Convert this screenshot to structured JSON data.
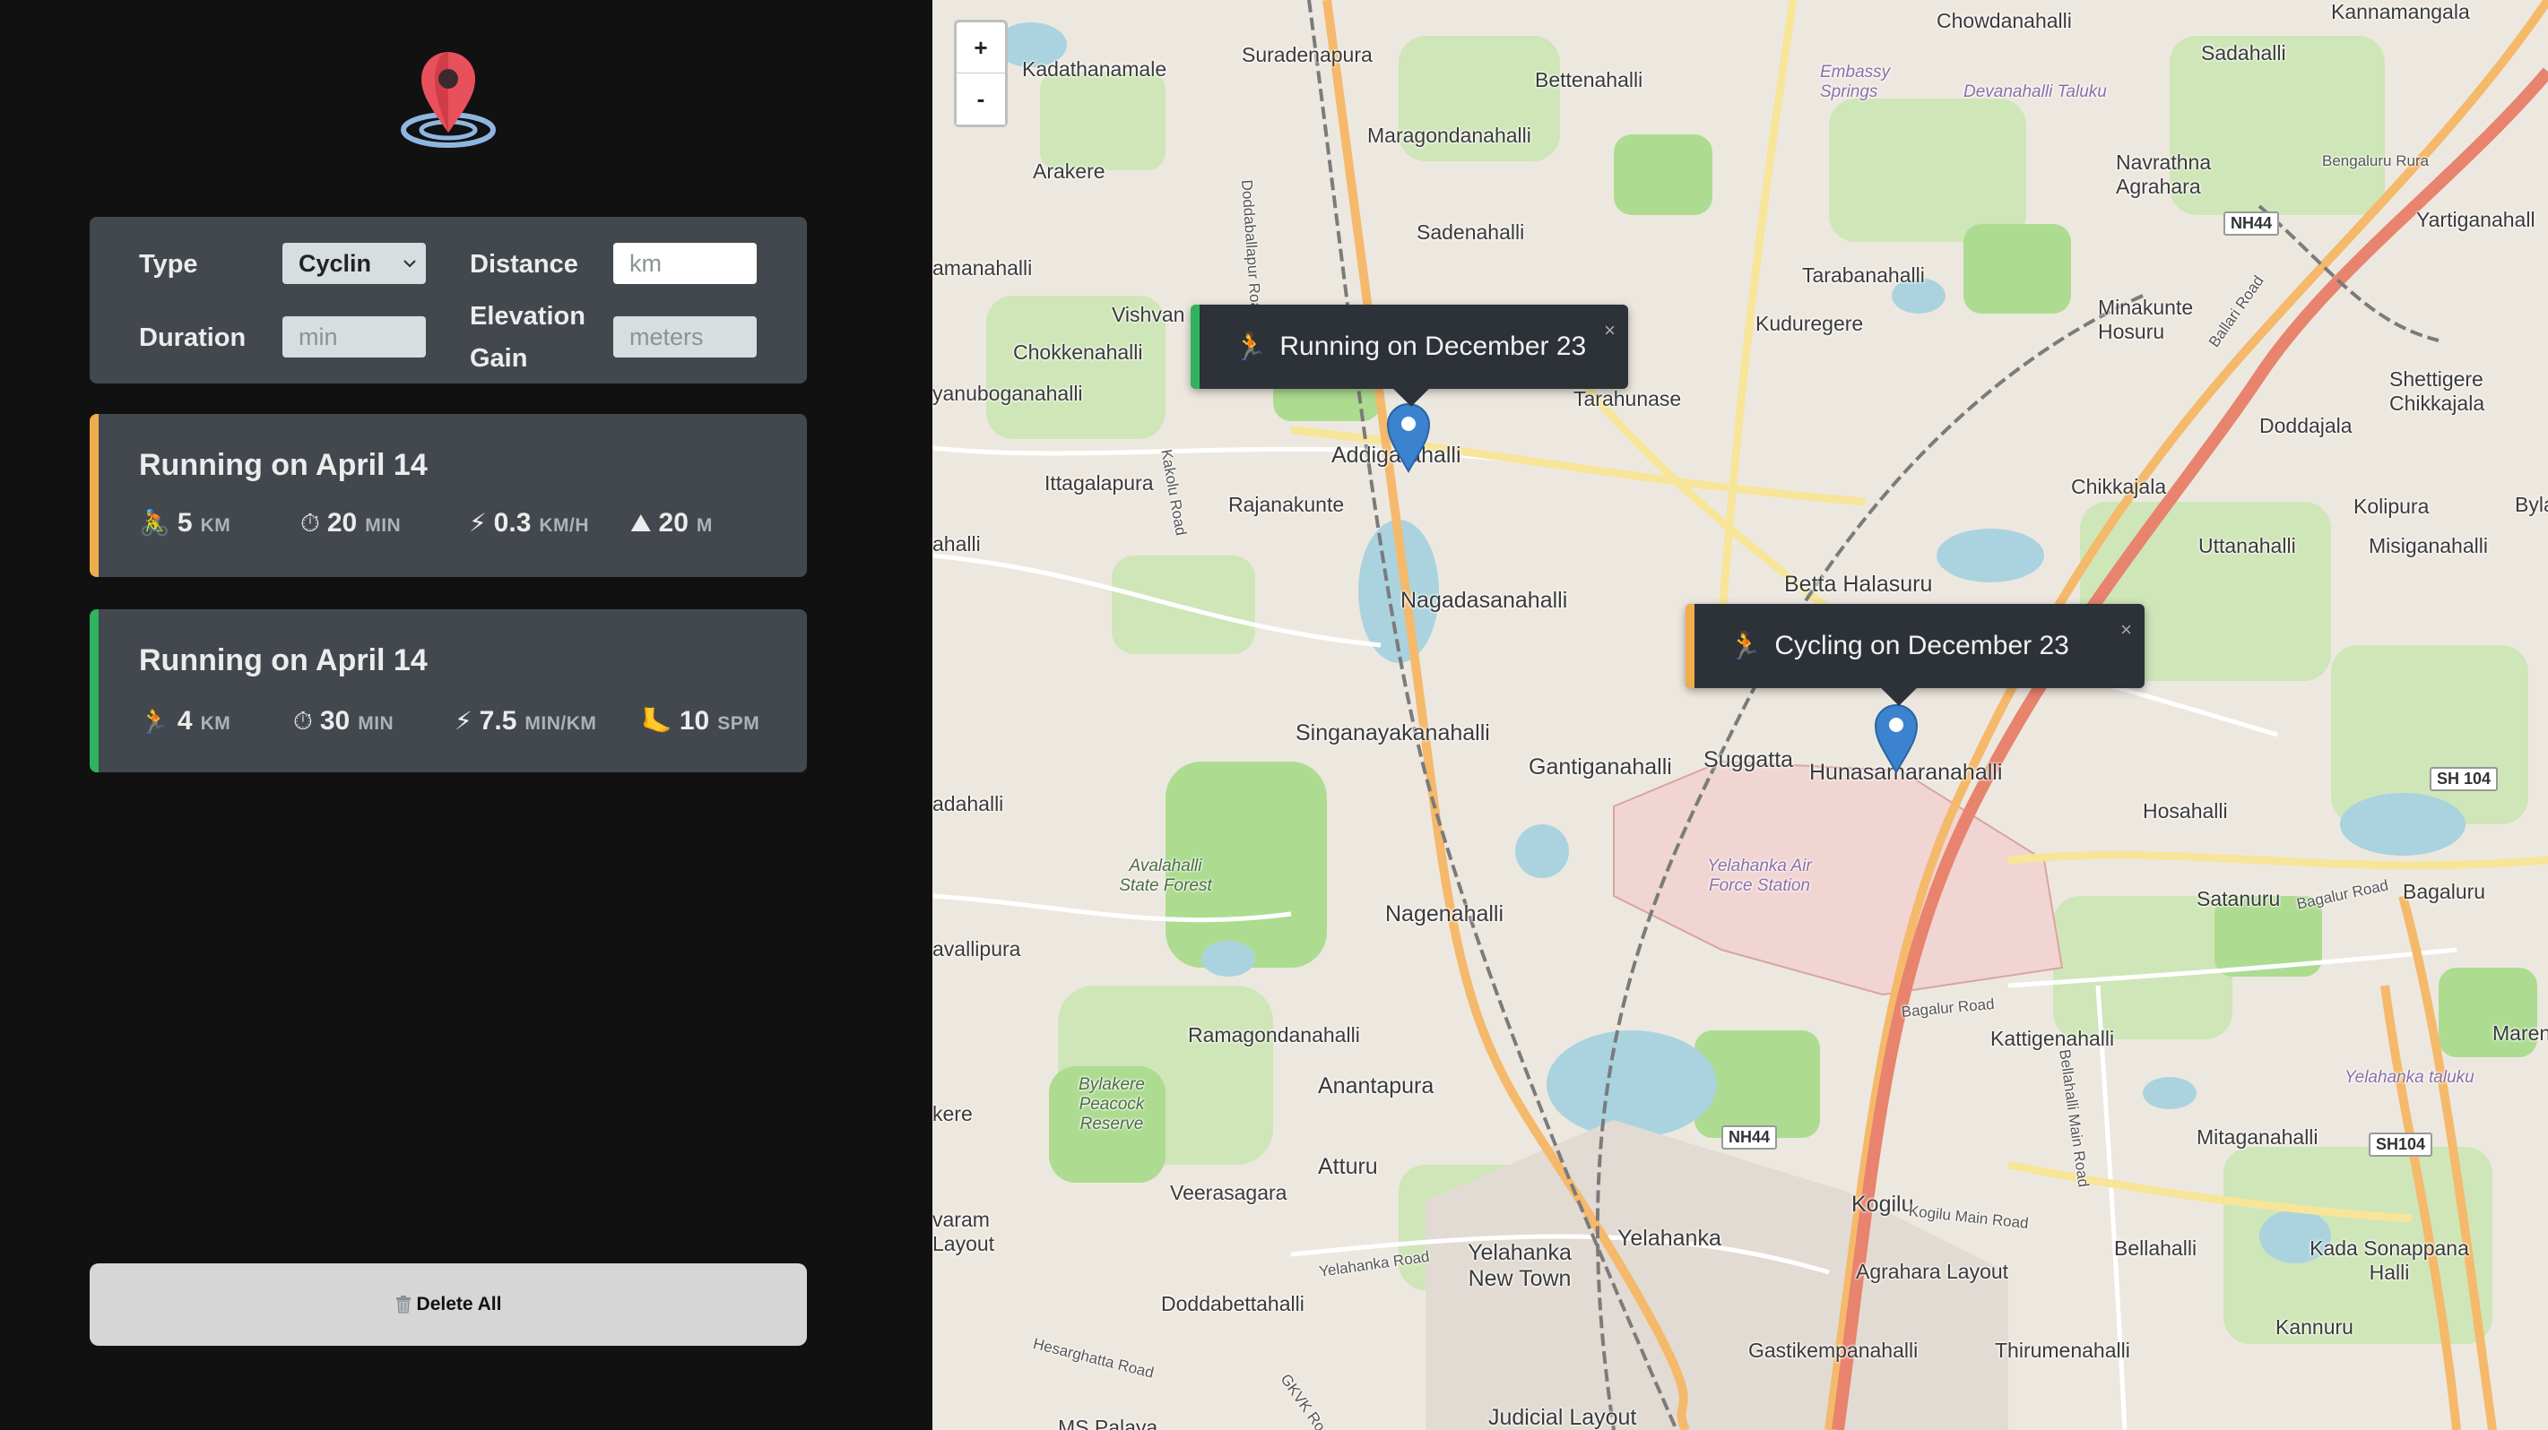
{
  "form": {
    "type_label": "Type",
    "type_value": "Cyclin",
    "distance_label": "Distance",
    "distance_placeholder": "km",
    "duration_label": "Duration",
    "duration_placeholder": "min",
    "elevation_label_line1": "Elevation",
    "elevation_label_line2": "Gain",
    "elevation_placeholder": "meters"
  },
  "workouts": [
    {
      "title": "Running on April 14",
      "accent": "#f0ad4e",
      "stats": [
        {
          "icon": "🚴",
          "value": "5",
          "unit": "KM"
        },
        {
          "icon": "⏱",
          "value": "20",
          "unit": "MIN"
        },
        {
          "icon": "⚡",
          "value": "0.3",
          "unit": "KM/H"
        },
        {
          "icon": "⛰",
          "value": "20",
          "unit": "M"
        }
      ]
    },
    {
      "title": "Running on April 14",
      "accent": "#2fb35e",
      "stats": [
        {
          "icon": "🏃",
          "value": "4",
          "unit": "KM"
        },
        {
          "icon": "⏱",
          "value": "30",
          "unit": "MIN"
        },
        {
          "icon": "⚡",
          "value": "7.5",
          "unit": "MIN/KM"
        },
        {
          "icon": "🦶",
          "value": "10",
          "unit": "SPM"
        }
      ]
    }
  ],
  "delete_all_label": "Delete All",
  "map": {
    "zoom_in": "+",
    "zoom_out": "-",
    "popups": [
      {
        "icon": "🏃",
        "text": "Running on December 23",
        "accent": "#2fb35e",
        "close": "×"
      },
      {
        "icon": "🏃",
        "text": "Cycling on December 23",
        "accent": "#f0ad4e",
        "close": "×"
      }
    ],
    "places": {
      "chowdanahalli": "Chowdanahalli",
      "kannamangala": "Kannamangala",
      "suradenapura": "Suradenapura",
      "kadathanamale": "Kadathanamale",
      "bettenahalli": "Bettenahalli",
      "sadahalli": "Sadahalli",
      "embassy_springs": "Embassy Springs",
      "devanahalli_taluku": "Devanahalli Taluku",
      "maragondanahalli": "Maragondanahalli",
      "navrathna_agrahara": "Navrathna Agrahara",
      "bengaluru_rural": "Bengaluru Rura",
      "arakere": "Arakere",
      "sadenahalli": "Sadenahalli",
      "yartiganahalli": "Yartiganahall",
      "amanahalli": "amanahalli",
      "tarabanahalli": "Tarabanahalli",
      "vishvanathapura": "Vishvan",
      "kuduregere": "Kuduregere",
      "minakunte_hosuru": "Minakunte Hosuru",
      "chokkenahalli": "Chokkenahalli",
      "shettigere": "Shettigere Chikkajala",
      "tarahunase": "Tarahunase",
      "yanuboganahalli": "yanuboganahalli",
      "doddajala": "Doddajala",
      "addigarahalli": "Addigarahalli",
      "ittagalapura": "Ittagalapura",
      "chikkajala": "Chikkajala",
      "kolipura": "Kolipura",
      "rajanakunte": "Rajanakunte",
      "uttanahalli": "Uttanahalli",
      "misiganahalli": "Misiganahalli",
      "byla": "Byla",
      "ahalli": "ahalli",
      "betta_halasuru": "Betta Halasuru",
      "nagadasanahalli": "Nagadasanahalli",
      "singanayakanahalli": "Singanayakanahalli",
      "gantiganahalli": "Gantiganahalli",
      "suggatta": "Suggatta",
      "hunasamaranahalli": "Hunasamaranahalli",
      "hosahalli": "Hosahalli",
      "adahalli": "adahalli",
      "avalahalli_forest": "Avalahalli State Forest",
      "yelahanka_afs": "Yelahanka Air Force Station",
      "satanuru": "Satanuru",
      "bagaluru": "Bagaluru",
      "avallipura": "avallipura",
      "nagenahalli": "Nagenahalli",
      "kattigenahalli": "Kattigenahalli",
      "ramagondanahalli": "Ramagondanahalli",
      "marena": "Marena",
      "bylakere": "Bylakere Peacock Reserve",
      "anantapura": "Anantapura",
      "yelahanka_taluku": "Yelahanka taluku",
      "mitaganahalli": "Mitaganahalli",
      "kere": "kere",
      "atturu": "Atturu",
      "veerasagara": "Veerasagara",
      "kogilu": "Kogilu",
      "varam_layout": "varam Layout",
      "yelahanka": "Yelahanka",
      "yelahanka_new_town": "Yelahanka New Town",
      "agrahara_layout": "Agrahara Layout",
      "bellahalli": "Bellahalli",
      "kada_sonappana": "Kada Sonappana Halli",
      "doddabettahalli": "Doddabettahalli",
      "gastikempanahalli": "Gastikempanahalli",
      "thirumenahalli": "Thirumenahalli",
      "kannuru": "Kannuru",
      "judicial_layout": "Judicial Layout",
      "ms_palaya": "MS Palaya"
    },
    "roads": {
      "doddaballapur_road": "Doddaballapur Road",
      "kakolu_road": "Kakolu Road",
      "bellary_road": "Ballari Road",
      "bagalur_road": "Bagalur Road",
      "bagalur_road2": "Bagalur Road",
      "bellahalli_main_road": "Bellahalli Main Road",
      "kogilu_main_road": "Kogilu Main Road",
      "yelahanka_road": "Yelahanka Road",
      "hesarghatta_road": "Hesarghatta Road",
      "gkvk_road": "GKVK Road"
    },
    "shields": {
      "nh44_top": "NH44",
      "nh44_bottom": "NH44",
      "sh104_right": "SH 104",
      "sh104_lower": "SH104"
    }
  }
}
